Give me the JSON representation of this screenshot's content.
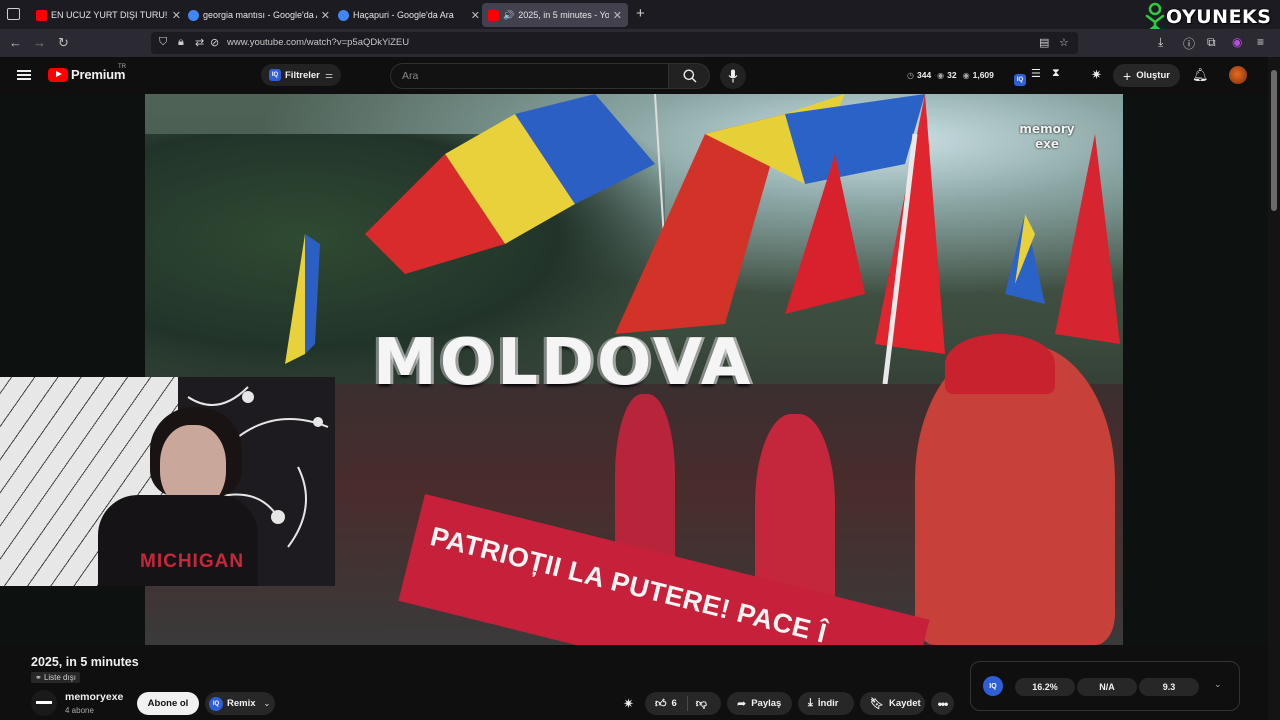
{
  "browser": {
    "tabs": [
      {
        "title": "EN UCUZ YURT DIŞI TURU! - Yo",
        "favicon_color": "#ff0000",
        "active": false
      },
      {
        "title": "georgia mantısı - Google'da Ara",
        "favicon_color": "#4285f4",
        "active": false
      },
      {
        "title": "Haçapuri - Google'da Ara",
        "favicon_color": "#4285f4",
        "active": false
      },
      {
        "title": "2025, in 5 minutes - YouTub",
        "favicon_color": "#ff0000",
        "active": true
      }
    ],
    "url": "www.youtube.com/watch?v=p5aQDkYiZEU"
  },
  "overlay_brand": "OYUNEKS",
  "youtube": {
    "logo_word": "Premium",
    "country_code": "TR",
    "filters_label": "Filtreler",
    "search_placeholder": "Ara",
    "stats": {
      "a": "344",
      "b": "32",
      "c": "1,609"
    },
    "create_label": "Oluştur"
  },
  "video": {
    "overlay_title": "MOLDOVA",
    "watermark_line1": "memory",
    "watermark_line2": "exe",
    "banner_text": "PATRIOȚII LA PUTERE! PACE Î",
    "shirt_text": "MICHIGAN",
    "title": "2025, in 5 minutes",
    "visibility": "Liste dışı",
    "channel_name": "memoryexe",
    "subscribers": "4 abone",
    "subscribe_label": "Abone ol",
    "remix_label": "Remix",
    "like_count": "6",
    "share_label": "Paylaş",
    "download_label": "İndir",
    "save_label": "Kaydet"
  },
  "iq_panel": {
    "logo": "IQ",
    "v1": "16.2%",
    "v2": "N/A",
    "v3": "9.3"
  },
  "colors": {
    "accent": "#ff0000",
    "iq_blue": "#2f5fd6",
    "banner_red": "#c6203a"
  }
}
